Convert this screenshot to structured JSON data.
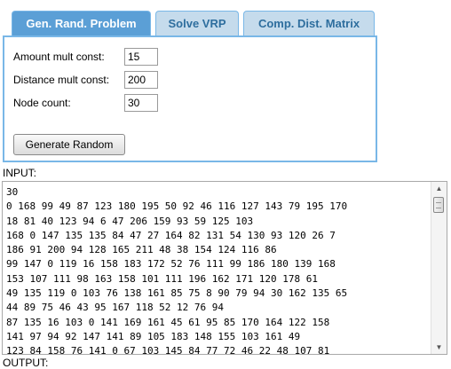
{
  "tabs": [
    {
      "label": "Gen. Rand. Problem",
      "active": true
    },
    {
      "label": "Solve VRP",
      "active": false
    },
    {
      "label": "Comp. Dist. Matrix",
      "active": false
    }
  ],
  "form": {
    "amount_label": "Amount mult const:",
    "amount_value": "15",
    "distance_label": "Distance mult const:",
    "distance_value": "200",
    "node_label": "Node count:",
    "node_value": "30",
    "generate_label": "Generate Random"
  },
  "input": {
    "label": "INPUT:",
    "lines": [
      "30",
      "0 168 99 49 87 123 180 195 50 92 46 116 127 143 79 195 170",
      "18 81 40 123 94 6 47 206 159 93 59 125 103",
      "168 0 147 135 135 84 47 27 164 82 131 54 130 93 120 26 7",
      "186 91 200 94 128 165 211 48 38 154 124 116 86",
      "99 147 0 119 16 158 183 172 52 76 111 99 186 180 139 168",
      "153 107 111 98 163 158 101 111 196 162 171 120 178 61",
      "49 135 119 0 103 76 138 161 85 75 8 90 79 94 30 162 135 65",
      "44 89 75 46 43 95 167 118 52 12 76 94",
      "87 135 16 103 0 141 169 161 45 61 95 85 170 164 122 158",
      "141 97 94 92 147 141 89 105 183 148 155 103 161 49",
      "123 84 158 76 141 0 67 103 145 84 77 72 46 22 48 107 81"
    ]
  },
  "output": {
    "label": "OUTPUT:"
  },
  "icons": {
    "scroll_up": "triangle-up",
    "scroll_down": "triangle-down"
  }
}
